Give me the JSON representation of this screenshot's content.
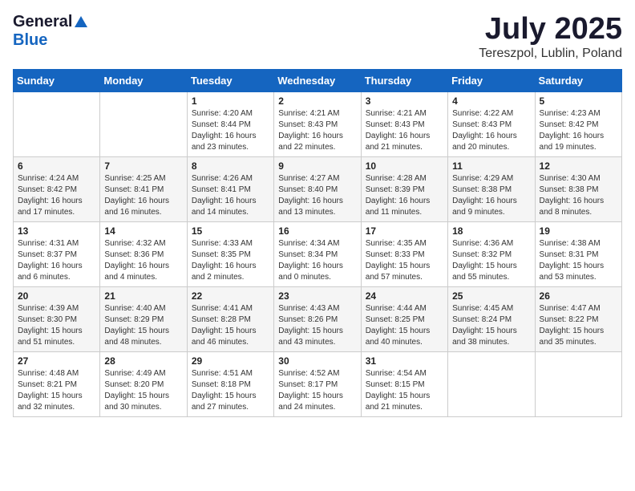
{
  "logo": {
    "general": "General",
    "blue": "Blue"
  },
  "title": "July 2025",
  "location": "Tereszpol, Lublin, Poland",
  "weekdays": [
    "Sunday",
    "Monday",
    "Tuesday",
    "Wednesday",
    "Thursday",
    "Friday",
    "Saturday"
  ],
  "weeks": [
    [
      {
        "day": "",
        "sunrise": "",
        "sunset": "",
        "daylight": ""
      },
      {
        "day": "",
        "sunrise": "",
        "sunset": "",
        "daylight": ""
      },
      {
        "day": "1",
        "sunrise": "Sunrise: 4:20 AM",
        "sunset": "Sunset: 8:44 PM",
        "daylight": "Daylight: 16 hours and 23 minutes."
      },
      {
        "day": "2",
        "sunrise": "Sunrise: 4:21 AM",
        "sunset": "Sunset: 8:43 PM",
        "daylight": "Daylight: 16 hours and 22 minutes."
      },
      {
        "day": "3",
        "sunrise": "Sunrise: 4:21 AM",
        "sunset": "Sunset: 8:43 PM",
        "daylight": "Daylight: 16 hours and 21 minutes."
      },
      {
        "day": "4",
        "sunrise": "Sunrise: 4:22 AM",
        "sunset": "Sunset: 8:43 PM",
        "daylight": "Daylight: 16 hours and 20 minutes."
      },
      {
        "day": "5",
        "sunrise": "Sunrise: 4:23 AM",
        "sunset": "Sunset: 8:42 PM",
        "daylight": "Daylight: 16 hours and 19 minutes."
      }
    ],
    [
      {
        "day": "6",
        "sunrise": "Sunrise: 4:24 AM",
        "sunset": "Sunset: 8:42 PM",
        "daylight": "Daylight: 16 hours and 17 minutes."
      },
      {
        "day": "7",
        "sunrise": "Sunrise: 4:25 AM",
        "sunset": "Sunset: 8:41 PM",
        "daylight": "Daylight: 16 hours and 16 minutes."
      },
      {
        "day": "8",
        "sunrise": "Sunrise: 4:26 AM",
        "sunset": "Sunset: 8:41 PM",
        "daylight": "Daylight: 16 hours and 14 minutes."
      },
      {
        "day": "9",
        "sunrise": "Sunrise: 4:27 AM",
        "sunset": "Sunset: 8:40 PM",
        "daylight": "Daylight: 16 hours and 13 minutes."
      },
      {
        "day": "10",
        "sunrise": "Sunrise: 4:28 AM",
        "sunset": "Sunset: 8:39 PM",
        "daylight": "Daylight: 16 hours and 11 minutes."
      },
      {
        "day": "11",
        "sunrise": "Sunrise: 4:29 AM",
        "sunset": "Sunset: 8:38 PM",
        "daylight": "Daylight: 16 hours and 9 minutes."
      },
      {
        "day": "12",
        "sunrise": "Sunrise: 4:30 AM",
        "sunset": "Sunset: 8:38 PM",
        "daylight": "Daylight: 16 hours and 8 minutes."
      }
    ],
    [
      {
        "day": "13",
        "sunrise": "Sunrise: 4:31 AM",
        "sunset": "Sunset: 8:37 PM",
        "daylight": "Daylight: 16 hours and 6 minutes."
      },
      {
        "day": "14",
        "sunrise": "Sunrise: 4:32 AM",
        "sunset": "Sunset: 8:36 PM",
        "daylight": "Daylight: 16 hours and 4 minutes."
      },
      {
        "day": "15",
        "sunrise": "Sunrise: 4:33 AM",
        "sunset": "Sunset: 8:35 PM",
        "daylight": "Daylight: 16 hours and 2 minutes."
      },
      {
        "day": "16",
        "sunrise": "Sunrise: 4:34 AM",
        "sunset": "Sunset: 8:34 PM",
        "daylight": "Daylight: 16 hours and 0 minutes."
      },
      {
        "day": "17",
        "sunrise": "Sunrise: 4:35 AM",
        "sunset": "Sunset: 8:33 PM",
        "daylight": "Daylight: 15 hours and 57 minutes."
      },
      {
        "day": "18",
        "sunrise": "Sunrise: 4:36 AM",
        "sunset": "Sunset: 8:32 PM",
        "daylight": "Daylight: 15 hours and 55 minutes."
      },
      {
        "day": "19",
        "sunrise": "Sunrise: 4:38 AM",
        "sunset": "Sunset: 8:31 PM",
        "daylight": "Daylight: 15 hours and 53 minutes."
      }
    ],
    [
      {
        "day": "20",
        "sunrise": "Sunrise: 4:39 AM",
        "sunset": "Sunset: 8:30 PM",
        "daylight": "Daylight: 15 hours and 51 minutes."
      },
      {
        "day": "21",
        "sunrise": "Sunrise: 4:40 AM",
        "sunset": "Sunset: 8:29 PM",
        "daylight": "Daylight: 15 hours and 48 minutes."
      },
      {
        "day": "22",
        "sunrise": "Sunrise: 4:41 AM",
        "sunset": "Sunset: 8:28 PM",
        "daylight": "Daylight: 15 hours and 46 minutes."
      },
      {
        "day": "23",
        "sunrise": "Sunrise: 4:43 AM",
        "sunset": "Sunset: 8:26 PM",
        "daylight": "Daylight: 15 hours and 43 minutes."
      },
      {
        "day": "24",
        "sunrise": "Sunrise: 4:44 AM",
        "sunset": "Sunset: 8:25 PM",
        "daylight": "Daylight: 15 hours and 40 minutes."
      },
      {
        "day": "25",
        "sunrise": "Sunrise: 4:45 AM",
        "sunset": "Sunset: 8:24 PM",
        "daylight": "Daylight: 15 hours and 38 minutes."
      },
      {
        "day": "26",
        "sunrise": "Sunrise: 4:47 AM",
        "sunset": "Sunset: 8:22 PM",
        "daylight": "Daylight: 15 hours and 35 minutes."
      }
    ],
    [
      {
        "day": "27",
        "sunrise": "Sunrise: 4:48 AM",
        "sunset": "Sunset: 8:21 PM",
        "daylight": "Daylight: 15 hours and 32 minutes."
      },
      {
        "day": "28",
        "sunrise": "Sunrise: 4:49 AM",
        "sunset": "Sunset: 8:20 PM",
        "daylight": "Daylight: 15 hours and 30 minutes."
      },
      {
        "day": "29",
        "sunrise": "Sunrise: 4:51 AM",
        "sunset": "Sunset: 8:18 PM",
        "daylight": "Daylight: 15 hours and 27 minutes."
      },
      {
        "day": "30",
        "sunrise": "Sunrise: 4:52 AM",
        "sunset": "Sunset: 8:17 PM",
        "daylight": "Daylight: 15 hours and 24 minutes."
      },
      {
        "day": "31",
        "sunrise": "Sunrise: 4:54 AM",
        "sunset": "Sunset: 8:15 PM",
        "daylight": "Daylight: 15 hours and 21 minutes."
      },
      {
        "day": "",
        "sunrise": "",
        "sunset": "",
        "daylight": ""
      },
      {
        "day": "",
        "sunrise": "",
        "sunset": "",
        "daylight": ""
      }
    ]
  ]
}
